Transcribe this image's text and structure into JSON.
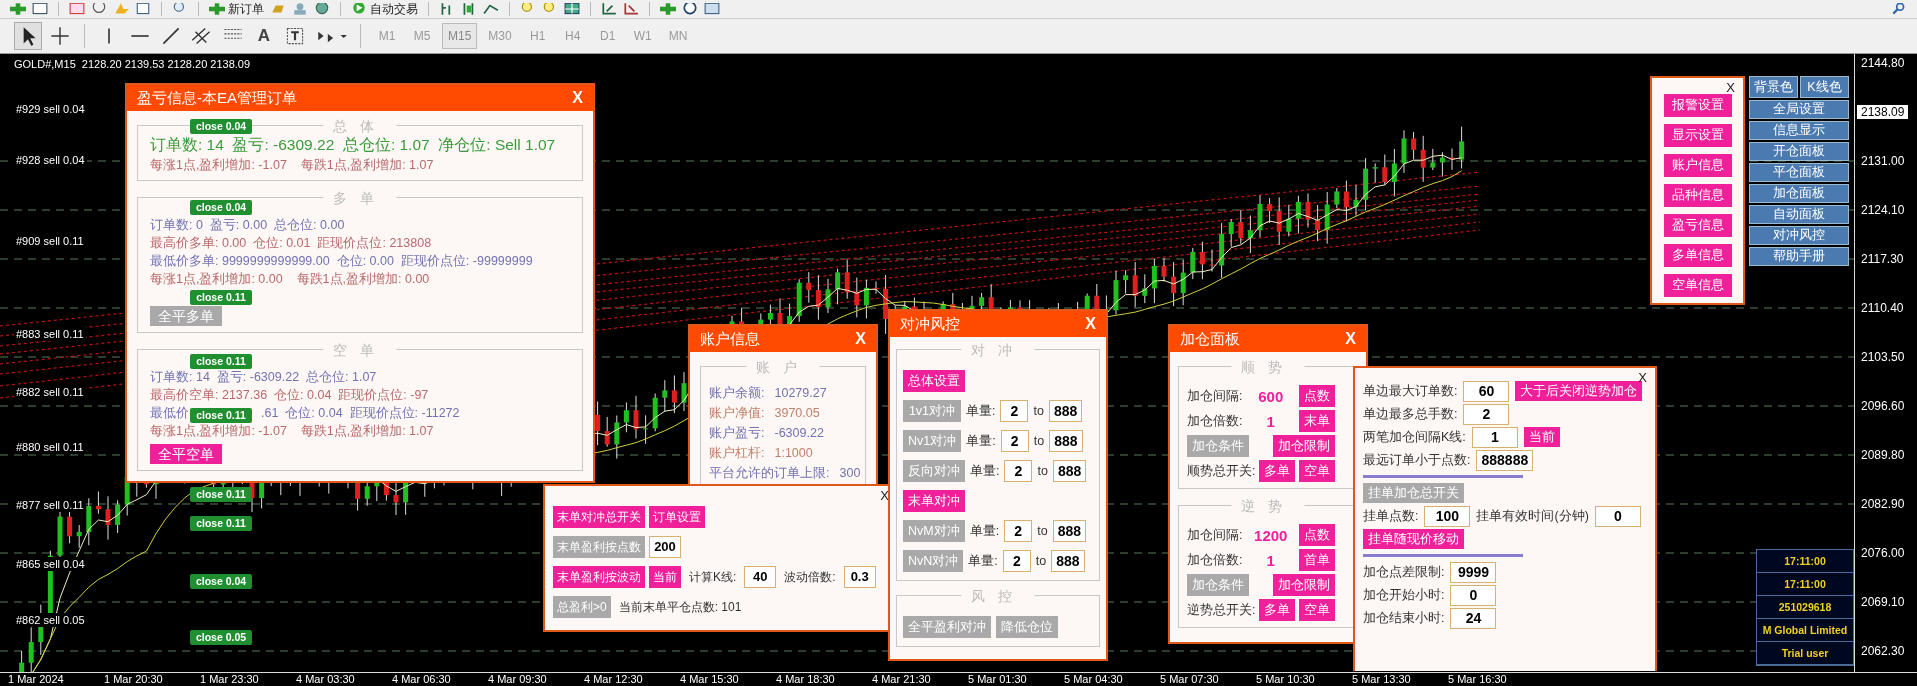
{
  "toolbar": {
    "new_order": "新订单",
    "auto_trading": "自动交易",
    "text_tool": "A",
    "timeframes": [
      {
        "label": "M1",
        "selected": false
      },
      {
        "label": "M5",
        "selected": false
      },
      {
        "label": "M15",
        "selected": true
      },
      {
        "label": "M30",
        "selected": false
      },
      {
        "label": "H1",
        "selected": false
      },
      {
        "label": "H4",
        "selected": false
      },
      {
        "label": "D1",
        "selected": false
      },
      {
        "label": "W1",
        "selected": false
      },
      {
        "label": "MN",
        "selected": false
      }
    ]
  },
  "chart": {
    "header": "GOLD#,M15  2128.20 2139.53 2128.20 2138.09",
    "order_labels": [
      "#929 sell 0.04",
      "#928 sell 0.04",
      "#909 sell 0.11",
      "#883 sell 0.11",
      "#882 sell 0.11",
      "#880 sell 0.11",
      "#877 sell 0.11",
      "#865 sell 0.04",
      "#862 sell 0.05"
    ],
    "close_badges": [
      "close 0.04",
      "close 0.04",
      "close 0.11",
      "close 0.11",
      "close 0.11",
      "close 0.11",
      "close 0.11",
      "close 0.04",
      "close 0.05"
    ]
  },
  "profit_panel": {
    "title": "盈亏信息-本EA管理订单",
    "close": "X",
    "sections": [
      {
        "heading": "总体",
        "lines": [
          {
            "kind": "headline",
            "color": "#3c9a3c",
            "texts": [
              "订单数: 14  盈亏: -6309.22  总仓位: 1.07  净仓位: Sell 1.07"
            ]
          },
          {
            "kind": "line",
            "color": "#b8696b",
            "texts": [
              "每涨1点,盈利增加: -1.07    每跌1点,盈利增加: 1.07"
            ]
          }
        ]
      },
      {
        "heading": "多单",
        "lines": [
          {
            "kind": "line",
            "color": "#7272b0",
            "texts": [
              "订单数: 0  盈亏: 0.00  总仓位: 0.00"
            ]
          },
          {
            "kind": "line",
            "color": "#b8696b",
            "texts": [
              "最高价多单: 0.00  仓位: 0.01  距现价点位: 213808"
            ]
          },
          {
            "kind": "line",
            "color": "#7272b0",
            "texts": [
              "最低价多单: 9999999999999.00  仓位: 0.00  距现价点位: -99999999"
            ]
          },
          {
            "kind": "line",
            "color": "#b8696b",
            "texts": [
              "每涨1点,盈利增加: 0.00    每跌1点,盈利增加: 0.00"
            ]
          }
        ],
        "button": {
          "label": "全平多单",
          "on": false
        }
      },
      {
        "heading": "空单",
        "lines": [
          {
            "kind": "line",
            "color": "#7272b0",
            "texts": [
              "订单数: 14  盈亏: -6309.22  总仓位: 1.07"
            ]
          },
          {
            "kind": "line",
            "color": "#b8696b",
            "texts": [
              "最高价空单: 2137.36  仓位: 0.04  距现价点位: -97"
            ]
          },
          {
            "kind": "line",
            "color": "#7272b0",
            "texts": [
              "最低价",
              ".61  仓位: 0.04  距现价点位: -11272"
            ]
          },
          {
            "kind": "line",
            "color": "#b8696b",
            "texts": [
              "每涨1点,盈利增加: -1.07    每跌1点,盈利增加: 1.07"
            ]
          }
        ],
        "button": {
          "label": "全平空单",
          "on": true
        }
      }
    ]
  },
  "account_panel": {
    "title": "账户信息",
    "close": "X",
    "heading": "账户",
    "rows": [
      {
        "label": "账户余额:",
        "value": "10279.27",
        "color": "#7272b0"
      },
      {
        "label": "账户净值:",
        "value": "3970.05",
        "color": "#c0806a"
      },
      {
        "label": "账户盈亏:",
        "value": "-6309.22",
        "color": "#7272b0"
      },
      {
        "label": "账户杠杆:",
        "value": "1:1000",
        "color": "#c0806a"
      },
      {
        "label": "平台允许的订单上限:",
        "value": "300",
        "color": "#7272b0"
      }
    ]
  },
  "last_order_panel": {
    "close": "X",
    "rows": [
      {
        "kind": "row",
        "items": [
          {
            "kind": "button",
            "label": "末单对冲总开关",
            "on": true
          },
          {
            "kind": "button",
            "label": "订单设置",
            "on": true
          }
        ]
      },
      {
        "kind": "row",
        "items": [
          {
            "kind": "button",
            "label": "末单盈利按点数",
            "on": false
          },
          {
            "kind": "field",
            "value": "200"
          }
        ]
      },
      {
        "kind": "row",
        "items": [
          {
            "kind": "button",
            "label": "末单盈利按波动",
            "on": true
          },
          {
            "kind": "button",
            "label": "当前",
            "on": true
          },
          {
            "kind": "label",
            "text": "计算K线:"
          },
          {
            "kind": "field",
            "value": "40"
          },
          {
            "kind": "label",
            "text": "波动倍数:"
          },
          {
            "kind": "field",
            "value": "0.3"
          }
        ]
      },
      {
        "kind": "row",
        "items": [
          {
            "kind": "button",
            "label": "总盈利>0",
            "on": false
          },
          {
            "kind": "text",
            "text": "当前末单平仓点数: 101"
          }
        ]
      }
    ]
  },
  "hedge_panel": {
    "title": "对冲风控",
    "close": "X",
    "sections": [
      {
        "heading": "对冲",
        "rows": [
          {
            "kind": "row",
            "items": [
              {
                "kind": "button",
                "label": "总体设置",
                "on": true
              }
            ]
          },
          {
            "kind": "row",
            "items": [
              {
                "kind": "button",
                "label": "1v1对冲",
                "on": false
              },
              {
                "kind": "label",
                "text": "单量:"
              },
              {
                "kind": "field",
                "value": "2"
              },
              {
                "kind": "label",
                "text": "to"
              },
              {
                "kind": "field",
                "value": "888"
              }
            ]
          },
          {
            "kind": "row",
            "items": [
              {
                "kind": "button",
                "label": "Nv1对冲",
                "on": false
              },
              {
                "kind": "label",
                "text": "单量:"
              },
              {
                "kind": "field",
                "value": "2"
              },
              {
                "kind": "label",
                "text": "to"
              },
              {
                "kind": "field",
                "value": "888"
              }
            ]
          },
          {
            "kind": "row",
            "items": [
              {
                "kind": "button",
                "label": "反向对冲",
                "on": false
              },
              {
                "kind": "label",
                "text": "单量:"
              },
              {
                "kind": "field",
                "value": "2"
              },
              {
                "kind": "label",
                "text": "to"
              },
              {
                "kind": "field",
                "value": "888"
              }
            ]
          },
          {
            "kind": "row",
            "items": [
              {
                "kind": "button",
                "label": "末单对冲",
                "on": true
              }
            ]
          },
          {
            "kind": "row",
            "items": [
              {
                "kind": "button",
                "label": "NvM对冲",
                "on": false
              },
              {
                "kind": "label",
                "text": "单量:"
              },
              {
                "kind": "field",
                "value": "2"
              },
              {
                "kind": "label",
                "text": "to"
              },
              {
                "kind": "field",
                "value": "888"
              }
            ]
          },
          {
            "kind": "row",
            "items": [
              {
                "kind": "button",
                "label": "NvN对冲",
                "on": false
              },
              {
                "kind": "label",
                "text": "单量:"
              },
              {
                "kind": "field",
                "value": "2"
              },
              {
                "kind": "label",
                "text": "to"
              },
              {
                "kind": "field",
                "value": "888"
              }
            ]
          }
        ]
      },
      {
        "heading": "风控",
        "rows": [
          {
            "kind": "row",
            "items": [
              {
                "kind": "button",
                "label": "全平盈利对冲",
                "on": false
              },
              {
                "kind": "button",
                "label": "降低仓位",
                "on": false
              }
            ]
          }
        ]
      }
    ]
  },
  "add_panel": {
    "title": "加仓面板",
    "close": "X",
    "sections": [
      {
        "heading": "顺势",
        "rows": [
          {
            "kind": "row",
            "items": [
              {
                "kind": "label",
                "text": "加仓间隔:"
              },
              {
                "kind": "value",
                "text": "600"
              },
              {
                "kind": "button",
                "label": "点数",
                "on": true
              }
            ]
          },
          {
            "kind": "row",
            "items": [
              {
                "kind": "label",
                "text": "加仓倍数:"
              },
              {
                "kind": "value",
                "text": "1"
              },
              {
                "kind": "button",
                "label": "末单",
                "on": true
              }
            ]
          },
          {
            "kind": "row",
            "items": [
              {
                "kind": "button",
                "label": "加仓条件",
                "on": false
              },
              {
                "kind": "button",
                "label": "加仓限制",
                "on": true
              }
            ]
          },
          {
            "kind": "row",
            "items": [
              {
                "kind": "label",
                "text": "顺势总开关:"
              },
              {
                "kind": "button",
                "label": "多单",
                "on": true
              },
              {
                "kind": "button",
                "label": "空单",
                "on": true
              }
            ]
          }
        ]
      },
      {
        "heading": "逆势",
        "rows": [
          {
            "kind": "row",
            "items": [
              {
                "kind": "label",
                "text": "加仓间隔:"
              },
              {
                "kind": "value",
                "text": "1200"
              },
              {
                "kind": "button",
                "label": "点数",
                "on": true
              }
            ]
          },
          {
            "kind": "row",
            "items": [
              {
                "kind": "label",
                "text": "加仓倍数:"
              },
              {
                "kind": "value",
                "text": "1"
              },
              {
                "kind": "button",
                "label": "首单",
                "on": true
              }
            ]
          },
          {
            "kind": "row",
            "items": [
              {
                "kind": "button",
                "label": "加仓条件",
                "on": false
              },
              {
                "kind": "button",
                "label": "加仓限制",
                "on": true
              }
            ]
          },
          {
            "kind": "row",
            "items": [
              {
                "kind": "label",
                "text": "逆势总开关:"
              },
              {
                "kind": "button",
                "label": "多单",
                "on": true
              },
              {
                "kind": "button",
                "label": "空单",
                "on": true
              }
            ]
          }
        ]
      }
    ]
  },
  "pending_panel": {
    "close": "X",
    "rows": [
      {
        "kind": "row",
        "items": [
          {
            "kind": "label",
            "text": "单边最大订单数:"
          },
          {
            "kind": "field",
            "value": "60"
          },
          {
            "kind": "button",
            "label": "大于后关闭逆势加仓",
            "on": true
          }
        ]
      },
      {
        "kind": "row",
        "items": [
          {
            "kind": "label",
            "text": "单边最多总手数:"
          },
          {
            "kind": "field",
            "value": "2"
          }
        ]
      },
      {
        "kind": "row",
        "items": [
          {
            "kind": "label",
            "text": "两笔加仓间隔K线:"
          },
          {
            "kind": "field",
            "value": "1"
          },
          {
            "kind": "button",
            "label": "当前",
            "on": true
          }
        ]
      },
      {
        "kind": "row",
        "items": [
          {
            "kind": "label",
            "text": "最远订单小于点数:"
          },
          {
            "kind": "field",
            "value": "888888"
          }
        ]
      },
      {
        "kind": "divider"
      },
      {
        "kind": "row",
        "items": [
          {
            "kind": "button",
            "label": "挂单加仓总开关",
            "on": false
          }
        ]
      },
      {
        "kind": "row",
        "items": [
          {
            "kind": "label",
            "text": "挂单点数:"
          },
          {
            "kind": "field",
            "value": "100"
          },
          {
            "kind": "label",
            "text": "挂单有效时间(分钟)"
          },
          {
            "kind": "field",
            "value": "0"
          }
        ]
      },
      {
        "kind": "row",
        "items": [
          {
            "kind": "button",
            "label": "挂单随现价移动",
            "on": true
          }
        ]
      },
      {
        "kind": "divider"
      },
      {
        "kind": "row",
        "items": [
          {
            "kind": "label",
            "text": "加仓点差限制:"
          },
          {
            "kind": "field",
            "value": "9999"
          }
        ]
      },
      {
        "kind": "row",
        "items": [
          {
            "kind": "label",
            "text": "加仓开始小时:"
          },
          {
            "kind": "field",
            "value": "0"
          }
        ]
      },
      {
        "kind": "row",
        "items": [
          {
            "kind": "label",
            "text": "加仓结束小时:"
          },
          {
            "kind": "field",
            "value": "24"
          }
        ]
      }
    ]
  },
  "menu_panel": {
    "close": "X",
    "buttons": [
      "报警设置",
      "显示设置",
      "账户信息",
      "品种信息",
      "盈亏信息",
      "多单信息",
      "空单信息"
    ]
  },
  "side_menu": {
    "top": [
      "背景色",
      "K线色"
    ],
    "items": [
      "全局设置",
      "信息显示",
      "开仓面板",
      "平仓面板",
      "加仓面板",
      "自动面板",
      "对冲风控",
      "帮助手册"
    ]
  },
  "info_box": [
    "17:11:00",
    "17:11:00",
    "251029618",
    "M Global Limited",
    "Trial user"
  ],
  "price_axis": [
    {
      "label": "2144.80",
      "current": false
    },
    {
      "label": "2138.09",
      "current": true
    },
    {
      "label": "2131.00",
      "current": false
    },
    {
      "label": "2124.10",
      "current": false
    },
    {
      "label": "2117.30",
      "current": false
    },
    {
      "label": "2110.40",
      "current": false
    },
    {
      "label": "2103.50",
      "current": false
    },
    {
      "label": "2096.60",
      "current": false
    },
    {
      "label": "2089.80",
      "current": false
    },
    {
      "label": "2082.90",
      "current": false
    },
    {
      "label": "2076.00",
      "current": false
    },
    {
      "label": "2069.10",
      "current": false
    },
    {
      "label": "2062.30",
      "current": false
    }
  ],
  "time_axis": [
    "1 Mar 2024",
    "1 Mar 20:30",
    "1 Mar 23:30",
    "4 Mar 03:30",
    "4 Mar 06:30",
    "4 Mar 09:30",
    "4 Mar 12:30",
    "4 Mar 15:30",
    "4 Mar 18:30",
    "4 Mar 21:30",
    "5 Mar 01:30",
    "5 Mar 04:30",
    "5 Mar 07:30",
    "5 Mar 10:30",
    "5 Mar 13:30",
    "5 Mar 16:30"
  ]
}
